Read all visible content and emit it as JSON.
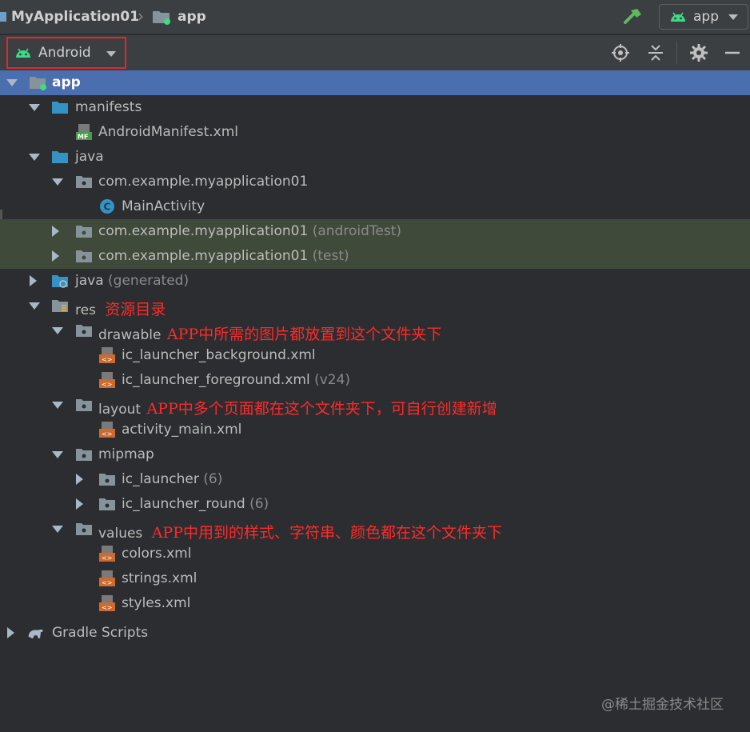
{
  "topbar": {
    "project_name": "MyApplication01",
    "module_name": "app",
    "run_config": "app"
  },
  "toolheader": {
    "view_mode": "Android"
  },
  "tree": {
    "root": "app",
    "manifests": "manifests",
    "android_manifest": "AndroidManifest.xml",
    "java": "java",
    "pkg_main": "com.example.myapplication01",
    "main_activity": "MainActivity",
    "pkg_android_test": "com.example.myapplication01",
    "android_test_suffix": "(androidTest)",
    "pkg_test": "com.example.myapplication01",
    "test_suffix": "(test)",
    "java_generated": "java",
    "generated_suffix": "(generated)",
    "res": "res",
    "res_note": "资源目录",
    "drawable": "drawable",
    "drawable_note": "APP中所需的图片都放置到这个文件夹下",
    "ic_launcher_background": "ic_launcher_background.xml",
    "ic_launcher_foreground": "ic_launcher_foreground.xml",
    "foreground_suffix": "(v24)",
    "layout": "layout",
    "layout_note": "APP中多个页面都在这个文件夹下，可自行创建新增",
    "activity_main": "activity_main.xml",
    "mipmap": "mipmap",
    "ic_launcher": "ic_launcher",
    "ic_launcher_count": "(6)",
    "ic_launcher_round": "ic_launcher_round",
    "ic_launcher_round_count": "(6)",
    "values": "values",
    "values_note": "APP中用到的样式、字符串、颜色都在这个文件夹下",
    "colors": "colors.xml",
    "strings": "strings.xml",
    "styles": "styles.xml",
    "gradle_scripts": "Gradle Scripts"
  },
  "watermark": "@稀土掘金技术社区",
  "colors": {
    "android_green": "#3ddc84",
    "selection_blue": "#4b6eaf",
    "annotation_red": "#ff2a2a",
    "folder_blue": "#3592c4"
  },
  "icons": [
    "android-icon",
    "folder-icon",
    "package-icon",
    "class-icon",
    "xml-file-icon",
    "manifest-icon",
    "gradle-icon",
    "hammer-icon",
    "locate-icon",
    "collapse-icon",
    "gear-icon",
    "minimize-icon"
  ]
}
